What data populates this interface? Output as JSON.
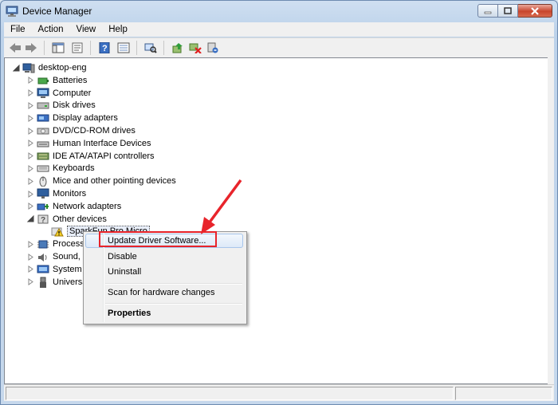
{
  "window": {
    "title": "Device Manager"
  },
  "menu": [
    "File",
    "Action",
    "View",
    "Help"
  ],
  "toolbar_icons": [
    "back-arrow-icon",
    "forward-arrow-icon",
    "show-hide-tree-icon",
    "properties-icon",
    "help-icon",
    "view-icon",
    "scan-hardware-icon",
    "update-driver-icon",
    "uninstall-icon",
    "disable-icon"
  ],
  "tree": {
    "root": "desktop-eng",
    "items": [
      {
        "label": "Batteries",
        "icon": "battery-icon"
      },
      {
        "label": "Computer",
        "icon": "computer-icon"
      },
      {
        "label": "Disk drives",
        "icon": "disk-drive-icon"
      },
      {
        "label": "Display adapters",
        "icon": "display-adapter-icon"
      },
      {
        "label": "DVD/CD-ROM drives",
        "icon": "dvd-drive-icon"
      },
      {
        "label": "Human Interface Devices",
        "icon": "hid-icon"
      },
      {
        "label": "IDE ATA/ATAPI controllers",
        "icon": "ide-controller-icon"
      },
      {
        "label": "Keyboards",
        "icon": "keyboard-icon"
      },
      {
        "label": "Mice and other pointing devices",
        "icon": "mouse-icon"
      },
      {
        "label": "Monitors",
        "icon": "monitor-icon"
      },
      {
        "label": "Network adapters",
        "icon": "network-adapter-icon"
      },
      {
        "label": "Other devices",
        "icon": "other-devices-icon"
      },
      {
        "label": "SparkFun Pro Micro",
        "icon": "warning-device-icon"
      },
      {
        "label": "Processo",
        "icon": "processor-icon"
      },
      {
        "label": "Sound, v",
        "icon": "sound-icon"
      },
      {
        "label": "System c",
        "icon": "system-icon"
      },
      {
        "label": "Universa",
        "icon": "usb-icon"
      }
    ]
  },
  "context_menu": {
    "update": "Update Driver Software...",
    "disable": "Disable",
    "uninstall": "Uninstall",
    "scan": "Scan for hardware changes",
    "properties": "Properties"
  },
  "colors": {
    "annotation_red": "#e8242b",
    "window_frame": "#bcd2ea",
    "highlight_border": "#a8c6eb"
  }
}
